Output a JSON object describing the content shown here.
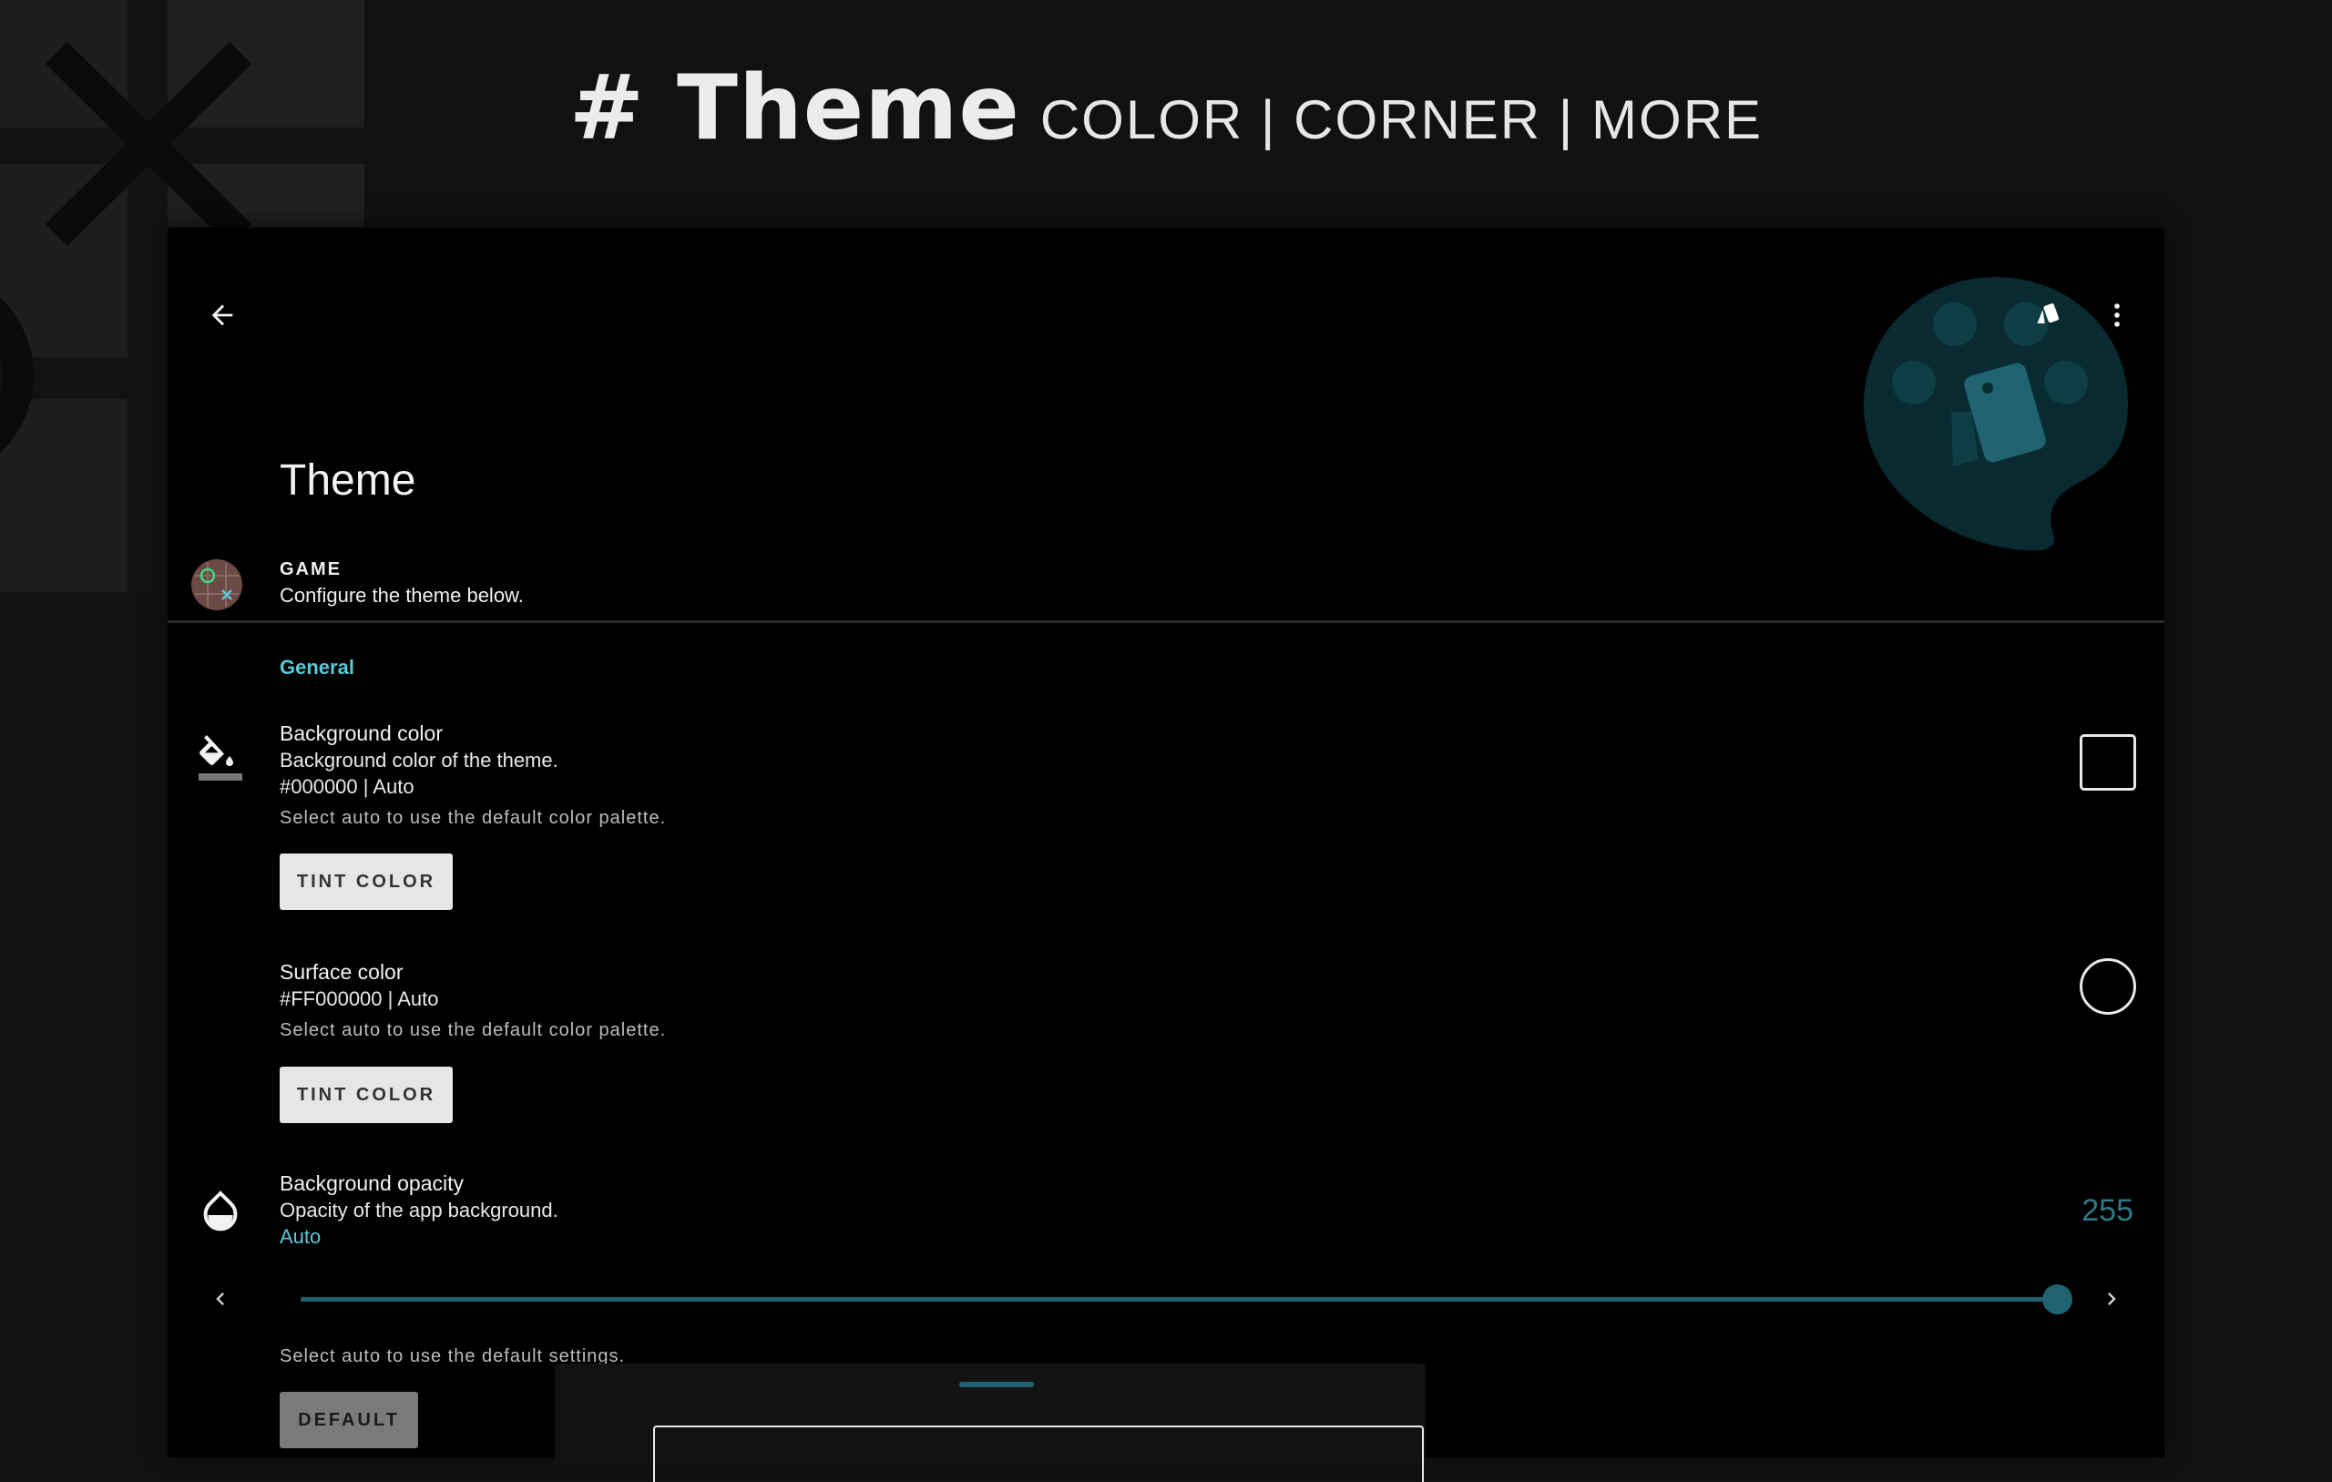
{
  "promo": {
    "title": "# Theme",
    "subtitle": "COLOR | CORNER | MORE"
  },
  "appbar": {
    "back_icon": "arrow-left-icon",
    "palette_icon": "palette-icon",
    "overflow_icon": "more-vert-icon"
  },
  "screen": {
    "title": "Theme"
  },
  "app_info": {
    "overline": "GAME",
    "description": "Configure the theme below."
  },
  "section": {
    "header": "General"
  },
  "background_color": {
    "icon": "format-color-fill-icon",
    "title": "Background color",
    "summary": "Background color of the theme.",
    "value": "#000000 | Auto",
    "hint": "Select auto to use the default color palette.",
    "button": "TINT COLOR",
    "swatch": "#000000"
  },
  "surface_color": {
    "title": "Surface color",
    "value": "#FF000000 | Auto",
    "hint": "Select auto to use the default color palette.",
    "button": "TINT COLOR",
    "swatch": "#000000"
  },
  "background_opacity": {
    "icon": "opacity-icon",
    "title": "Background opacity",
    "summary": "Opacity of the app background.",
    "auto_label": "Auto",
    "value": "255",
    "slider_fraction": 1.0,
    "hint": "Select auto to use the default settings.",
    "button": "DEFAULT"
  },
  "colors": {
    "accent": "#5ac8d8",
    "primary_dark": "#1f6371",
    "screen_background": "#000000",
    "page_background": "#111111"
  }
}
